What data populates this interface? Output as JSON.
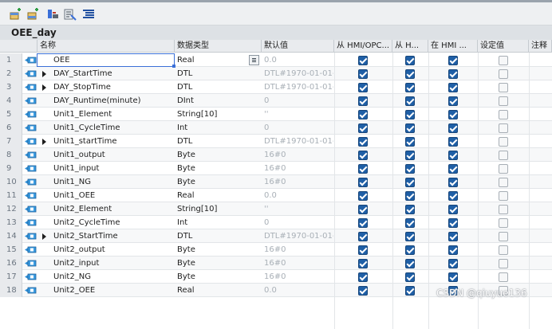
{
  "editor": {
    "block_title": "OEE_day"
  },
  "columns": [
    "名称",
    "数据类型",
    "默认值",
    "从 HMI/OPC...",
    "从 H...",
    "在 HMI ...",
    "设定值",
    "注释"
  ],
  "rows": [
    {
      "num": "1",
      "name": "OEE",
      "type": "Real",
      "default": "0.0",
      "expand": false,
      "hmi1": true,
      "hmi2": true,
      "hmi3": true,
      "setpoint": false
    },
    {
      "num": "2",
      "name": "DAY_StartTime",
      "type": "DTL",
      "default": "DTL#1970-01-01-",
      "expand": true,
      "hmi1": true,
      "hmi2": true,
      "hmi3": true,
      "setpoint": false
    },
    {
      "num": "3",
      "name": "DAY_StopTime",
      "type": "DTL",
      "default": "DTL#1970-01-01-",
      "expand": true,
      "hmi1": true,
      "hmi2": true,
      "hmi3": true,
      "setpoint": false
    },
    {
      "num": "4",
      "name": "DAY_Runtime(minute)",
      "type": "DInt",
      "default": "0",
      "expand": false,
      "hmi1": true,
      "hmi2": true,
      "hmi3": true,
      "setpoint": false
    },
    {
      "num": "5",
      "name": "Unit1_Element",
      "type": "String[10]",
      "default": "''",
      "expand": false,
      "hmi1": true,
      "hmi2": true,
      "hmi3": true,
      "setpoint": false
    },
    {
      "num": "6",
      "name": "Unit1_CycleTime",
      "type": "Int",
      "default": "0",
      "expand": false,
      "hmi1": true,
      "hmi2": true,
      "hmi3": true,
      "setpoint": false
    },
    {
      "num": "7",
      "name": "Unit1_startTime",
      "type": "DTL",
      "default": "DTL#1970-01-01-",
      "expand": true,
      "hmi1": true,
      "hmi2": true,
      "hmi3": true,
      "setpoint": false
    },
    {
      "num": "8",
      "name": "Unit1_output",
      "type": "Byte",
      "default": "16#0",
      "expand": false,
      "hmi1": true,
      "hmi2": true,
      "hmi3": true,
      "setpoint": false
    },
    {
      "num": "9",
      "name": "Unit1_input",
      "type": "Byte",
      "default": "16#0",
      "expand": false,
      "hmi1": true,
      "hmi2": true,
      "hmi3": true,
      "setpoint": false
    },
    {
      "num": "10",
      "name": "Unit1_NG",
      "type": "Byte",
      "default": "16#0",
      "expand": false,
      "hmi1": true,
      "hmi2": true,
      "hmi3": true,
      "setpoint": false
    },
    {
      "num": "11",
      "name": "Unit1_OEE",
      "type": "Real",
      "default": "0.0",
      "expand": false,
      "hmi1": true,
      "hmi2": true,
      "hmi3": true,
      "setpoint": false
    },
    {
      "num": "12",
      "name": "Unit2_Element",
      "type": "String[10]",
      "default": "''",
      "expand": false,
      "hmi1": true,
      "hmi2": true,
      "hmi3": true,
      "setpoint": false
    },
    {
      "num": "13",
      "name": "Unit2_CycleTime",
      "type": "Int",
      "default": "0",
      "expand": false,
      "hmi1": true,
      "hmi2": true,
      "hmi3": true,
      "setpoint": false
    },
    {
      "num": "14",
      "name": "Unit2_StartTime",
      "type": "DTL",
      "default": "DTL#1970-01-01-",
      "expand": true,
      "hmi1": true,
      "hmi2": true,
      "hmi3": true,
      "setpoint": false
    },
    {
      "num": "15",
      "name": "Unit2_output",
      "type": "Byte",
      "default": "16#0",
      "expand": false,
      "hmi1": true,
      "hmi2": true,
      "hmi3": true,
      "setpoint": false
    },
    {
      "num": "16",
      "name": "Unit2_input",
      "type": "Byte",
      "default": "16#0",
      "expand": false,
      "hmi1": true,
      "hmi2": true,
      "hmi3": true,
      "setpoint": false
    },
    {
      "num": "17",
      "name": "Unit2_NG",
      "type": "Byte",
      "default": "16#0",
      "expand": false,
      "hmi1": true,
      "hmi2": true,
      "hmi3": true,
      "setpoint": false
    },
    {
      "num": "18",
      "name": "Unit2_OEE",
      "type": "Real",
      "default": "0.0",
      "expand": false,
      "hmi1": true,
      "hmi2": true,
      "hmi3": true,
      "setpoint": false
    }
  ],
  "watermark": "CSDN @qiuyue136",
  "colors": {
    "checkbox_on": "#1f5fa6",
    "selection": "#3a6fd8",
    "header_bg": "#e9ebee"
  }
}
